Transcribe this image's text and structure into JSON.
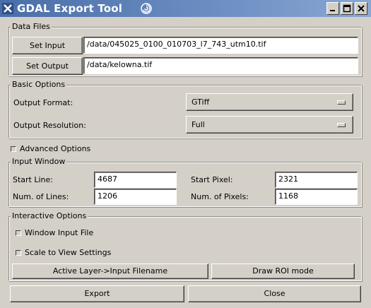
{
  "window": {
    "title": "GDAL Export Tool",
    "icons": {
      "app": "x-window-icon",
      "extra": "swirl-icon",
      "minimize": "minimize-icon",
      "maximize": "maximize-icon",
      "close": "close-icon"
    }
  },
  "data_files": {
    "title": "Data Files",
    "set_input_label": "Set Input",
    "input_value": "/data/045025_0100_010703_l7_743_utm10.tif",
    "set_output_label": "Set Output",
    "output_value": "/data/kelowna.tif"
  },
  "basic_options": {
    "title": "Basic Options",
    "output_format_label": "Output Format:",
    "output_format_value": "GTiff",
    "output_resolution_label": "Output Resolution:",
    "output_resolution_value": "Full"
  },
  "advanced_options": {
    "label": "Advanced Options",
    "checked": false
  },
  "input_window": {
    "title": "Input Window",
    "start_line_label": "Start Line:",
    "start_line_value": "4687",
    "start_pixel_label": "Start Pixel:",
    "start_pixel_value": "2321",
    "num_lines_label": "Num. of Lines:",
    "num_lines_value": "1206",
    "num_pixels_label": "Num. of Pixels:",
    "num_pixels_value": "1168"
  },
  "interactive_options": {
    "title": "Interactive Options",
    "window_input_file_label": "Window Input File",
    "scale_to_view_label": "Scale to View Settings",
    "active_layer_button": "Active Layer->Input Filename",
    "draw_roi_button": "Draw ROI mode"
  },
  "footer": {
    "export_label": "Export",
    "close_label": "Close"
  },
  "colors": {
    "titlebar_start": "#4a6ea8",
    "titlebar_end": "#8aa7d4",
    "window_bg": "#d4d0c8",
    "entry_bg": "#ffffff"
  }
}
